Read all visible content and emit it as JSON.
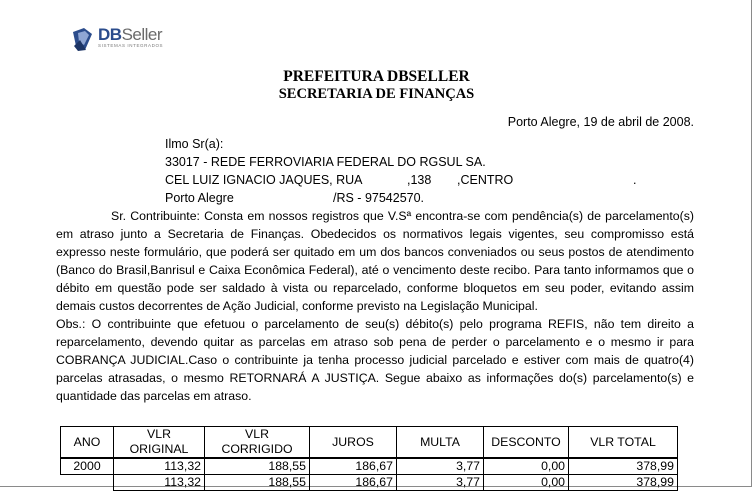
{
  "logo": {
    "name_bold": "DB",
    "name_light": "Seller",
    "tagline": "SISTEMAS INTEGRADOS"
  },
  "header": {
    "title": "PREFEITURA DBSELLER",
    "subtitle": "SECRETARIA DE FINANÇAS"
  },
  "date_line": "Porto Alegre, 19 de abril de 2008.",
  "address": {
    "salutation": "Ilmo Sr(a):",
    "line1": "33017 - REDE FERROVIARIA FEDERAL DO RGSUL SA.",
    "street": "CEL LUIZ IGNACIO JAQUES, RUA",
    "number": ",138",
    "district": ",CENTRO",
    "district_end": ".",
    "city": "Porto Alegre",
    "state_zip": "/RS - 97542570."
  },
  "paragraphs": {
    "p1": "Sr. Contribuinte: Consta em nossos registros que V.Sª encontra-se com pendência(s) de parcelamento(s) em atraso junto a Secretaria de Finanças. Obedecidos os normativos legais vigentes, seu compromisso está expresso neste formulário, que poderá ser quitado em um dos bancos conveniados ou seus postos de atendimento (Banco do Brasil,Banrisul e Caixa Econômica Federal), até o vencimento deste recibo. Para tanto informamos que o débito em questão pode ser saldado à vista ou reparcelado, conforme bloquetos em seu poder, evitando assim demais custos decorrentes de Ação Judicial, conforme previsto na Legislação Municipal.",
    "p2": "Obs.: O contribuinte que efetuou o parcelamento de seu(s) débito(s) pelo programa REFIS, não tem direito a reparcelamento, devendo quitar as parcelas em atraso sob pena de perder o parcelamento e o mesmo ir para COBRANÇA JUDICIAL.Caso o contribuinte ja tenha processo judicial parcelado e estiver com mais de quatro(4) parcelas atrasadas, o mesmo RETORNARÁ A JUSTIÇA. Segue abaixo as informações do(s) parcelamento(s) e quantidade das parcelas em atraso."
  },
  "table": {
    "headers": [
      "ANO",
      "VLR ORIGINAL",
      "VLR CORRIGIDO",
      "JUROS",
      "MULTA",
      "DESCONTO",
      "VLR TOTAL"
    ],
    "rows": [
      [
        "2000",
        "113,32",
        "188,55",
        "186,67",
        "3,77",
        "0,00",
        "378,99"
      ]
    ],
    "totals": [
      "113,32",
      "188,55",
      "186,67",
      "3,77",
      "0,00",
      "378,99"
    ]
  }
}
